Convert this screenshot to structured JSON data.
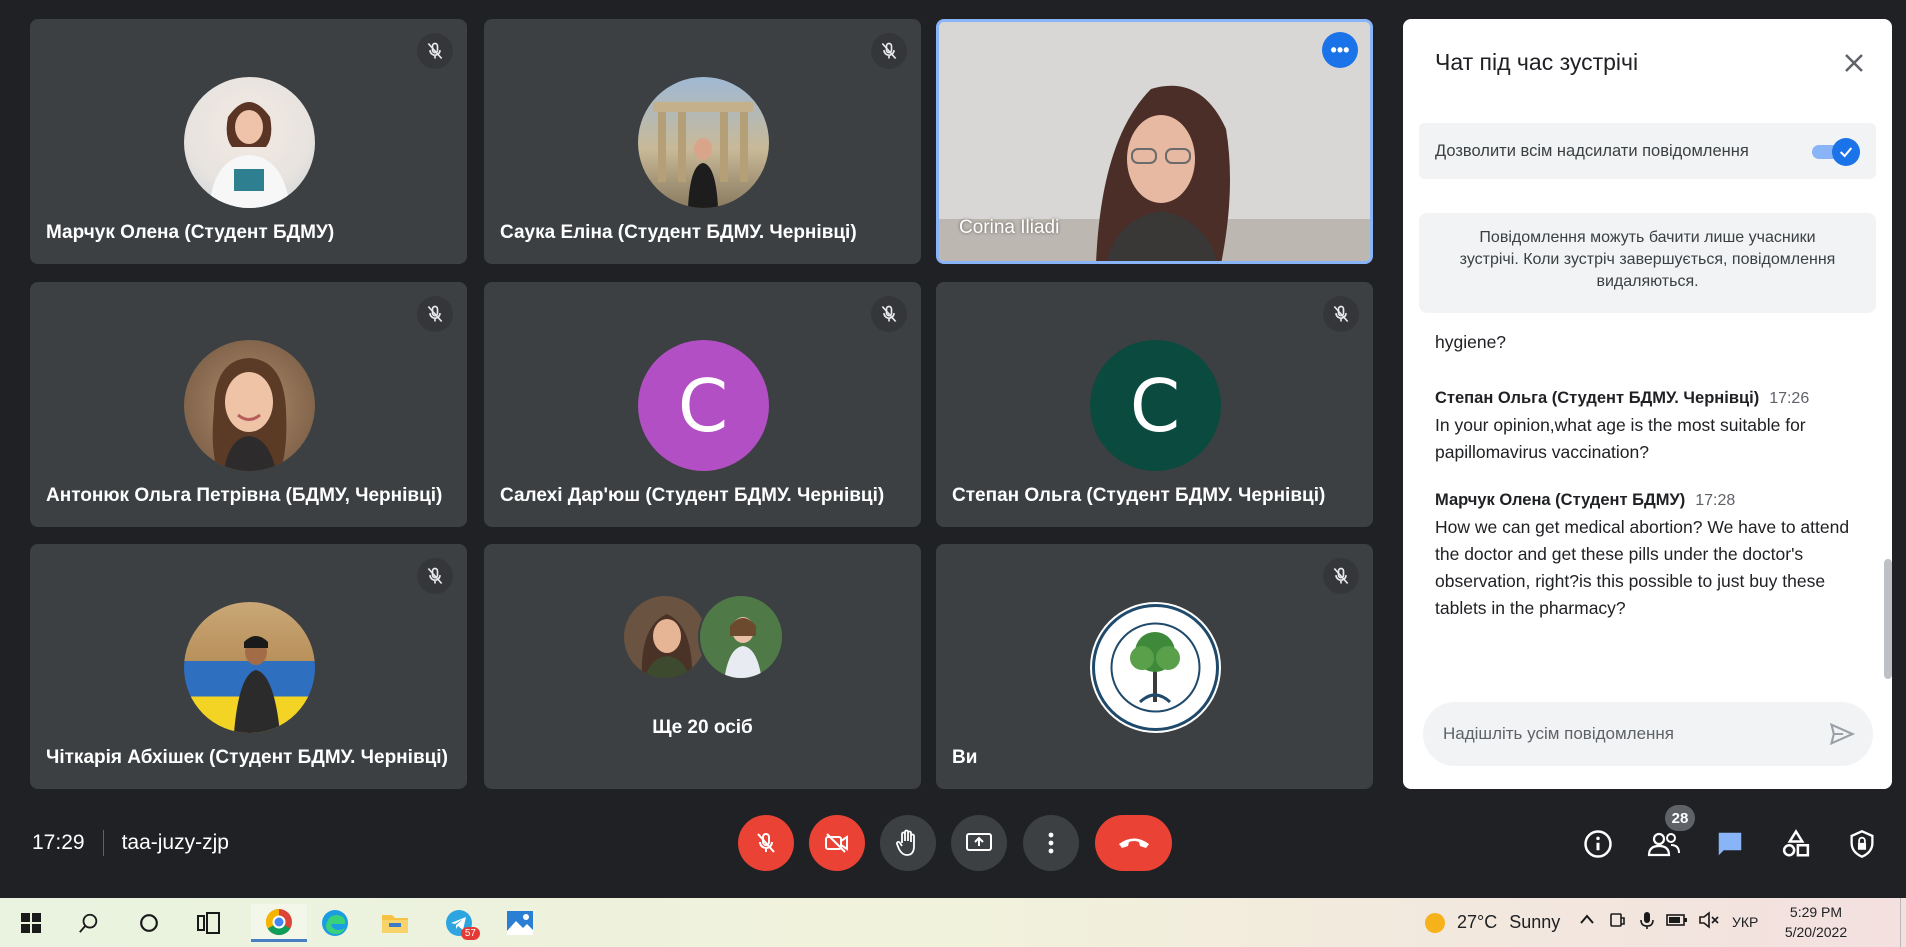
{
  "tiles": [
    {
      "name": "Марчук Олена (Студент БДМУ)"
    },
    {
      "name": "Саука Еліна (Студент БДМУ. Чернівці)"
    },
    {
      "name": "Corina Iliadi"
    },
    {
      "name": "Антонюк Ольга Петрівна (БДМУ, Чернівці)"
    },
    {
      "name": "Салехі Дар'юш (Студент БДМУ. Чернівці)",
      "letter": "C",
      "color": "#b24fc4"
    },
    {
      "name": "Степан Ольга (Студент БДМУ. Чернівці)",
      "letter": "C",
      "color": "#0b4a3f"
    },
    {
      "name": "Чіткарія Абхішек (Студент БДМУ. Чернівці)"
    },
    {
      "name": "Ще 20 осіб"
    },
    {
      "name": "Ви"
    }
  ],
  "chat": {
    "title": "Чат під час зустрічі",
    "allow_label": "Дозволити всім надсилати повідомлення",
    "info": "Повідомлення можуть бачити лише учасники зустрічі. Коли зустріч завершується, повідомлення видаляються.",
    "messages": [
      {
        "sender": "",
        "time": "",
        "text": "hygiene?"
      },
      {
        "sender": "Степан Ольга (Студент БДМУ. Чернівці)",
        "time": "17:26",
        "text": "In your opinion,what age is the most suitable for papillomavirus vaccination?"
      },
      {
        "sender": "Марчук Олена (Студент БДМУ)",
        "time": "17:28",
        "text": "How we can get medical abortion? We have to attend the doctor and get these pills under the doctor's observation, right?is this possible to just buy these tablets in the pharmacy?"
      }
    ],
    "input_placeholder": "Надішліть усім повідомлення"
  },
  "meeting": {
    "time": "17:29",
    "code": "taa-juzy-zjp",
    "participants_count": "28"
  },
  "taskbar": {
    "temperature": "27°C",
    "weather": "Sunny",
    "language": "УКР",
    "clock_time": "5:29 PM",
    "clock_date": "5/20/2022",
    "telegram_badge": "57"
  },
  "colors": {
    "accent": "#1a73e8",
    "danger": "#ea4335",
    "tile": "#3c4043",
    "background": "#202124"
  }
}
